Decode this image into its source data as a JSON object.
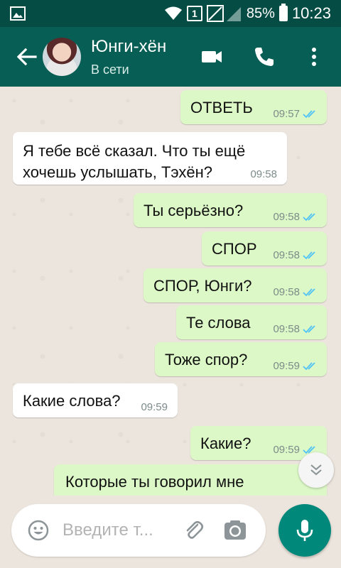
{
  "status_bar": {
    "sim_label": "1",
    "battery": "85%",
    "time": "10:23"
  },
  "header": {
    "contact_name": "Юнги-хён",
    "contact_status": "В сети"
  },
  "messages": [
    {
      "direction": "out",
      "text": "ОТВЕТЬ",
      "time": "09:57",
      "read": true
    },
    {
      "direction": "in",
      "text": "Я тебе всё сказал. Что ты ещё хочешь услышать, Тэхён?",
      "time": "09:58"
    },
    {
      "direction": "out",
      "text": "Ты серьёзно?",
      "time": "09:58",
      "read": true
    },
    {
      "direction": "out",
      "text": "СПОР",
      "time": "09:58",
      "read": true
    },
    {
      "direction": "out",
      "text": "СПОР, Юнги?",
      "time": "09:58",
      "read": true
    },
    {
      "direction": "out",
      "text": "Те слова",
      "time": "09:58",
      "read": true
    },
    {
      "direction": "out",
      "text": "Тоже спор?",
      "time": "09:59",
      "read": true
    },
    {
      "direction": "in",
      "text": "Какие слова?",
      "time": "09:59"
    },
    {
      "direction": "out",
      "text": "Какие?",
      "time": "09:59",
      "read": true
    },
    {
      "direction": "out",
      "text": "Которые ты говорил мне",
      "time": "",
      "read": true
    }
  ],
  "composer": {
    "placeholder": "Введите т..."
  },
  "colors": {
    "header": "#075e54",
    "status_bar": "#054d44",
    "outgoing_bubble": "#dcf8c6",
    "incoming_bubble": "#ffffff",
    "read_ticks": "#4fc3f7",
    "mic_button": "#00897b"
  },
  "icons": [
    "gallery-icon",
    "wifi-icon",
    "sim-icon",
    "signal-icon",
    "battery-icon",
    "back-arrow-icon",
    "video-call-icon",
    "phone-icon",
    "more-vert-icon",
    "double-check-icon",
    "chevron-down-icon",
    "emoji-icon",
    "attach-icon",
    "camera-icon",
    "mic-icon"
  ]
}
